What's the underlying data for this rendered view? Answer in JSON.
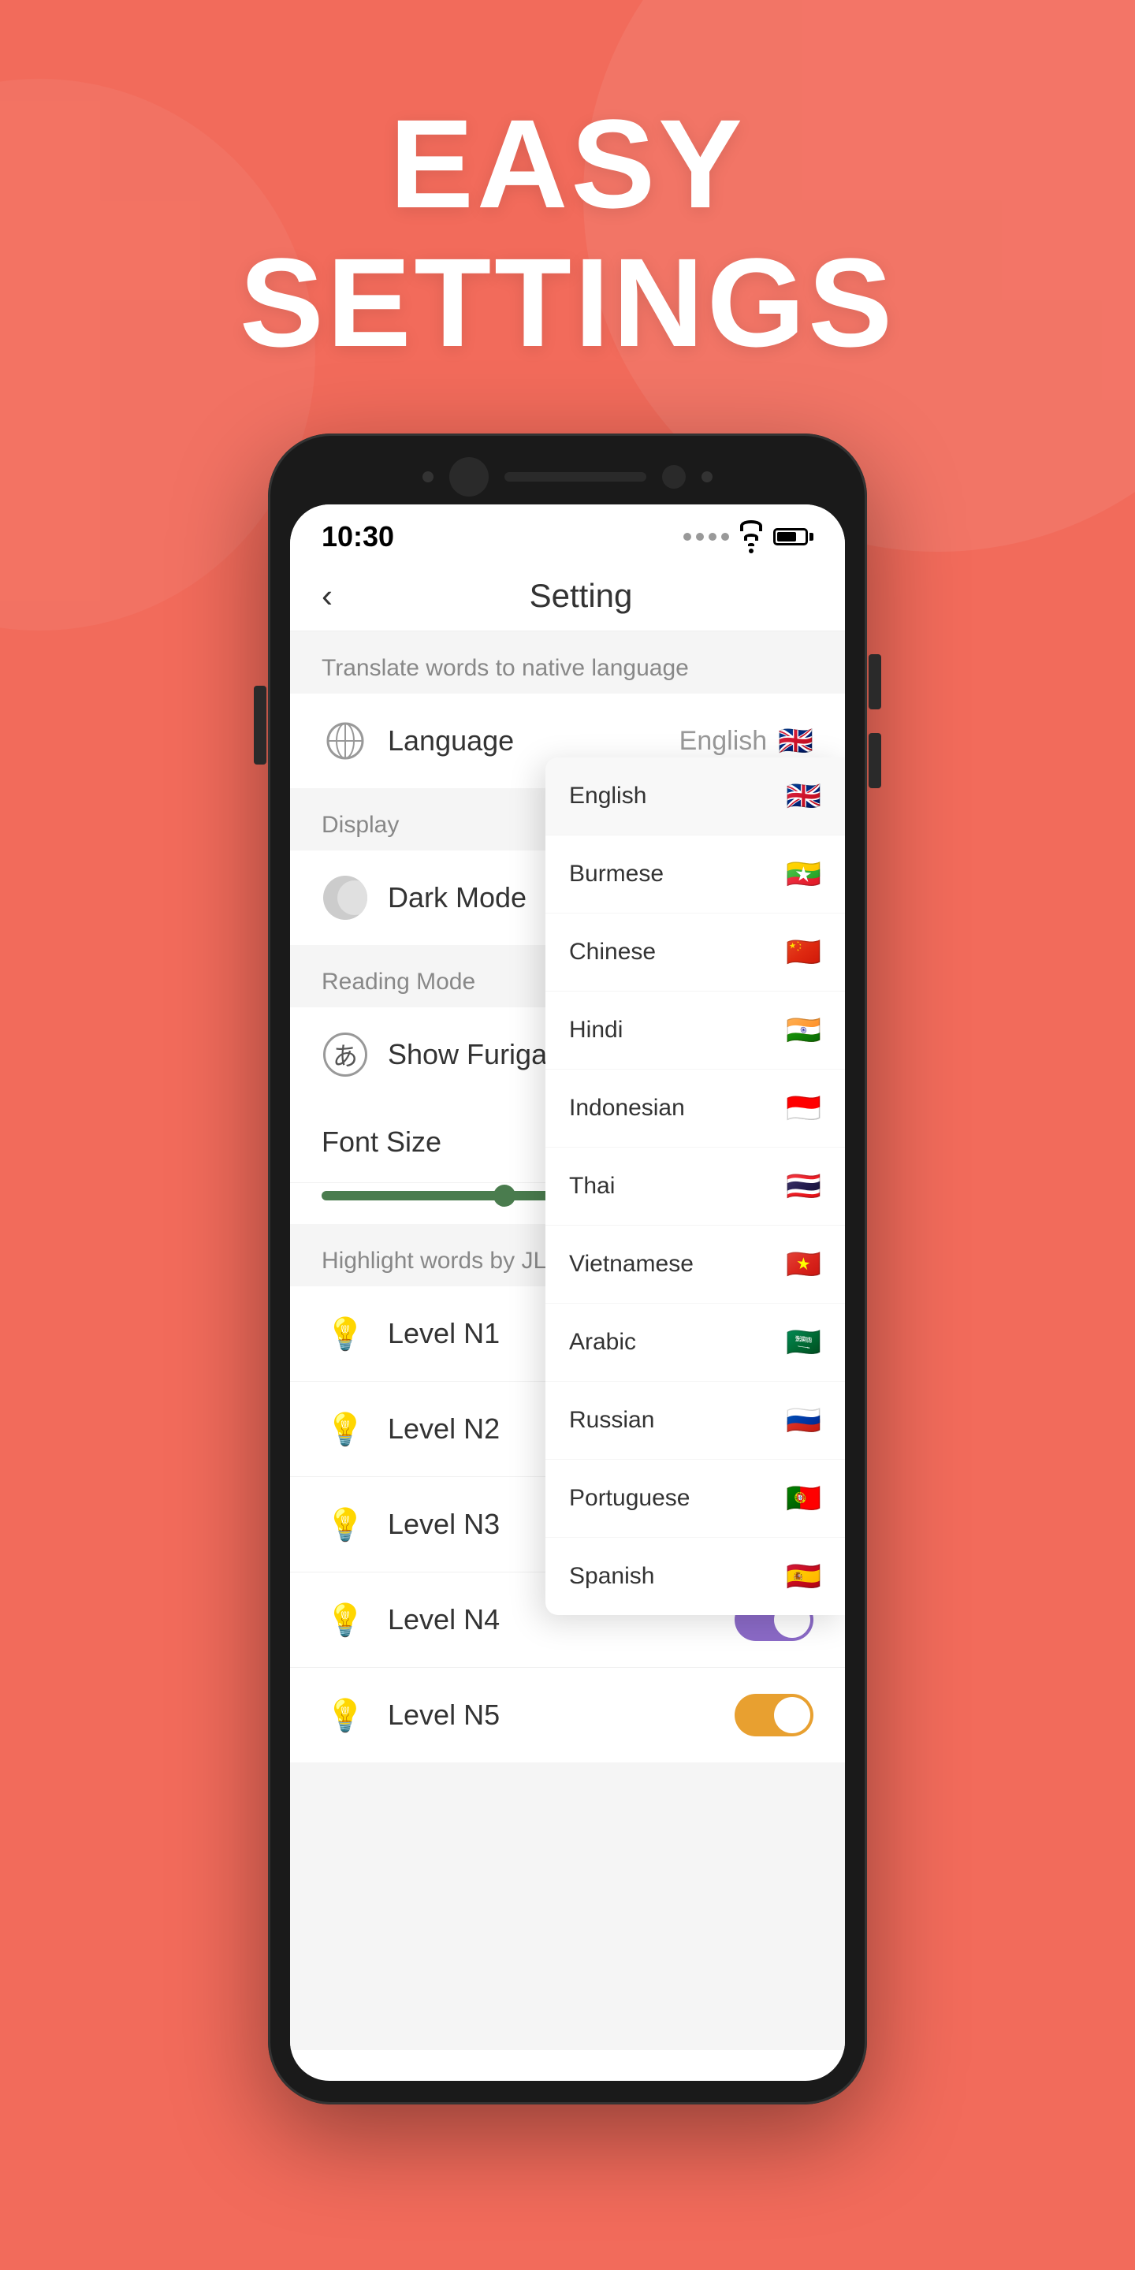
{
  "page": {
    "background_color": "#F26B5B",
    "header": {
      "line1": "EASY",
      "line2": "SETTINGS"
    }
  },
  "phone": {
    "status_bar": {
      "time": "10:30"
    },
    "app": {
      "back_label": "‹",
      "title": "Setting"
    },
    "settings": {
      "section_translate": "Translate words to native language",
      "language_label": "Language",
      "language_value": "English",
      "section_display": "Display",
      "dark_mode_label": "Dark Mode",
      "section_reading": "Reading Mode",
      "show_furigana_label": "Show Furigana",
      "font_size_label": "Font Size",
      "section_jlpt": "Highlight words by JLPT le",
      "levels": [
        {
          "id": "n1",
          "label": "Level N1",
          "color": "red",
          "toggle": null
        },
        {
          "id": "n2",
          "label": "Level N2",
          "color": "green",
          "toggle": null
        },
        {
          "id": "n3",
          "label": "Level N3",
          "color": "blue",
          "toggle": "on-blue"
        },
        {
          "id": "n4",
          "label": "Level N4",
          "color": "purple",
          "toggle": "on-purple"
        },
        {
          "id": "n5",
          "label": "Level N5",
          "color": "orange",
          "toggle": "on-orange"
        }
      ]
    },
    "dropdown": {
      "languages": [
        {
          "id": "english",
          "name": "English",
          "flag": "🇬🇧",
          "selected": true
        },
        {
          "id": "burmese",
          "name": "Burmese",
          "flag": "🇲🇲",
          "selected": false
        },
        {
          "id": "chinese",
          "name": "Chinese",
          "flag": "🇨🇳",
          "selected": false
        },
        {
          "id": "hindi",
          "name": "Hindi",
          "flag": "🇮🇳",
          "selected": false
        },
        {
          "id": "indonesian",
          "name": "Indonesian",
          "flag": "🇮🇩",
          "selected": false
        },
        {
          "id": "thai",
          "name": "Thai",
          "flag": "🇹🇭",
          "selected": false
        },
        {
          "id": "vietnamese",
          "name": "Vietnamese",
          "flag": "🇻🇳",
          "selected": false
        },
        {
          "id": "arabic",
          "name": "Arabic",
          "flag": "🇸🇦",
          "selected": false
        },
        {
          "id": "russian",
          "name": "Russian",
          "flag": "🇷🇺",
          "selected": false
        },
        {
          "id": "portuguese",
          "name": "Portuguese",
          "flag": "🇵🇹",
          "selected": false
        },
        {
          "id": "spanish",
          "name": "Spanish",
          "flag": "🇪🇸",
          "selected": false
        }
      ]
    }
  }
}
